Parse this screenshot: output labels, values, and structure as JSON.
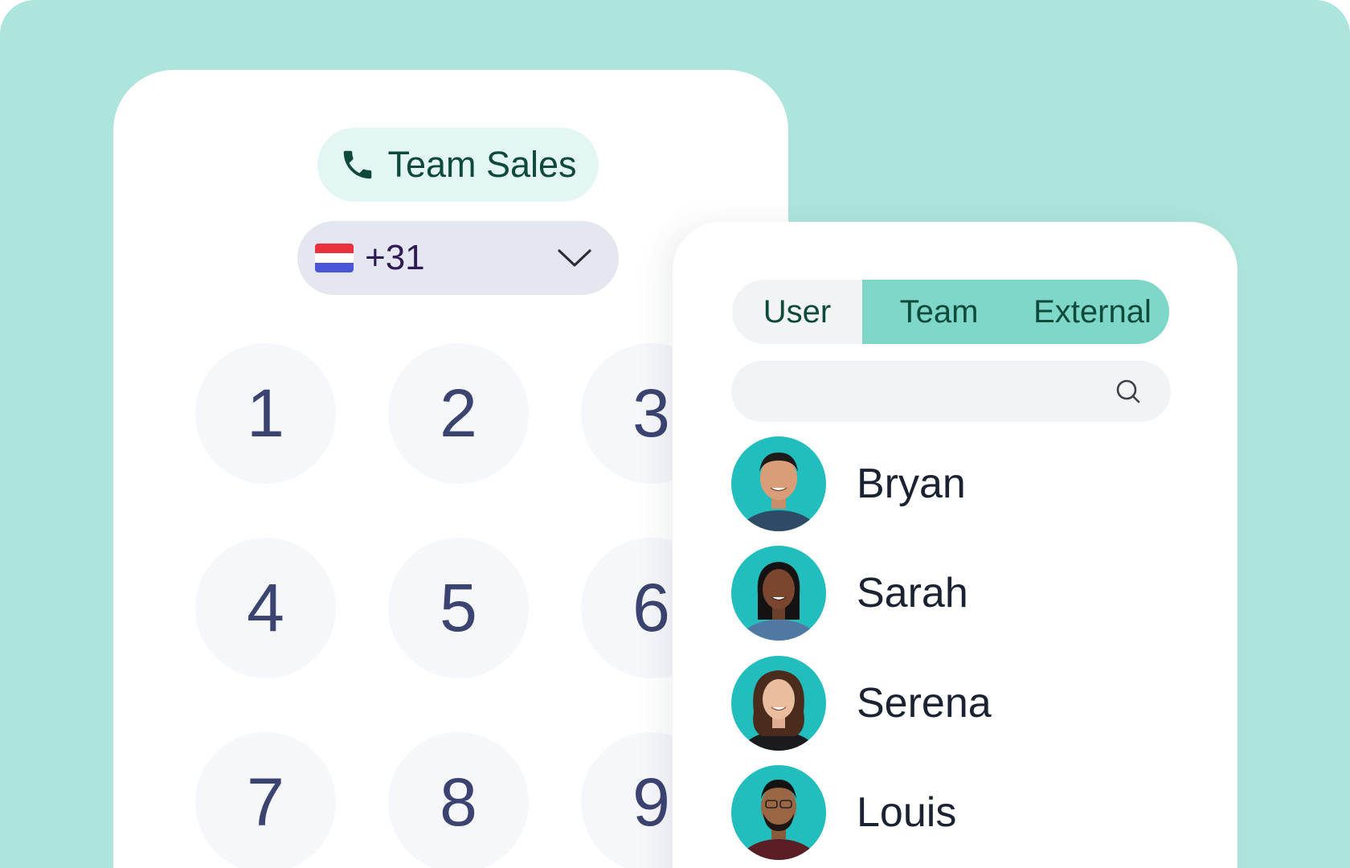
{
  "dialer": {
    "caller_id": {
      "label": "Team Sales",
      "icon": "phone-icon"
    },
    "country": {
      "flag": "netherlands-flag",
      "code": "+31",
      "icon": "chevron-down-icon",
      "flag_colors": [
        "#e8313b",
        "#ffffff",
        "#4a56d8"
      ]
    },
    "keys": [
      "1",
      "2",
      "3",
      "4",
      "5",
      "6",
      "7",
      "8",
      "9"
    ]
  },
  "directory": {
    "tabs": [
      {
        "label": "User",
        "active": false
      },
      {
        "label": "Team",
        "active": true
      },
      {
        "label": "External",
        "active": true
      }
    ],
    "search": {
      "placeholder": "",
      "icon": "search-icon"
    },
    "contacts": [
      {
        "name": "Bryan"
      },
      {
        "name": "Sarah"
      },
      {
        "name": "Serena"
      },
      {
        "name": "Louis"
      }
    ]
  },
  "colors": {
    "background": "#ade5dc",
    "accent": "#7ed7c8",
    "avatar_bg": "#22bdbd",
    "text_dark": "#0e4a3c",
    "key_text": "#3b4370"
  }
}
